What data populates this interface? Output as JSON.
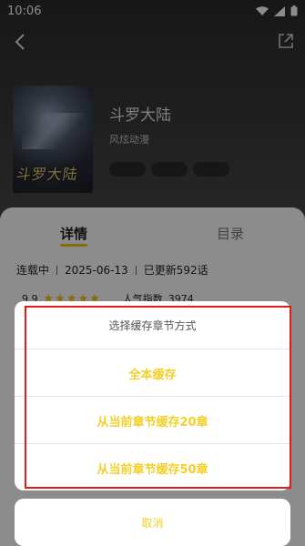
{
  "status_bar": {
    "time": "10:06"
  },
  "comic": {
    "cover_title": "斗罗大陆",
    "title": "斗罗大陆",
    "subtitle": "风炫动漫",
    "tags": [
      "",
      "",
      ""
    ]
  },
  "tabs": {
    "detail": "详情",
    "catalog": "目录"
  },
  "meta": {
    "status": "连载中",
    "date": "2025-06-13",
    "updated": "已更新592话"
  },
  "rating": {
    "score": "9.9",
    "stars": "★★★★★",
    "popularity_label": "人气指数",
    "popularity": "3974"
  },
  "sheet": {
    "title": "选择缓存章节方式",
    "options": [
      "全本缓存",
      "从当前章节缓存20章",
      "从当前章节缓存50章"
    ],
    "cancel": "取消"
  },
  "colors": {
    "accent": "#f3cf2a",
    "highlight": "#e11b1b"
  }
}
